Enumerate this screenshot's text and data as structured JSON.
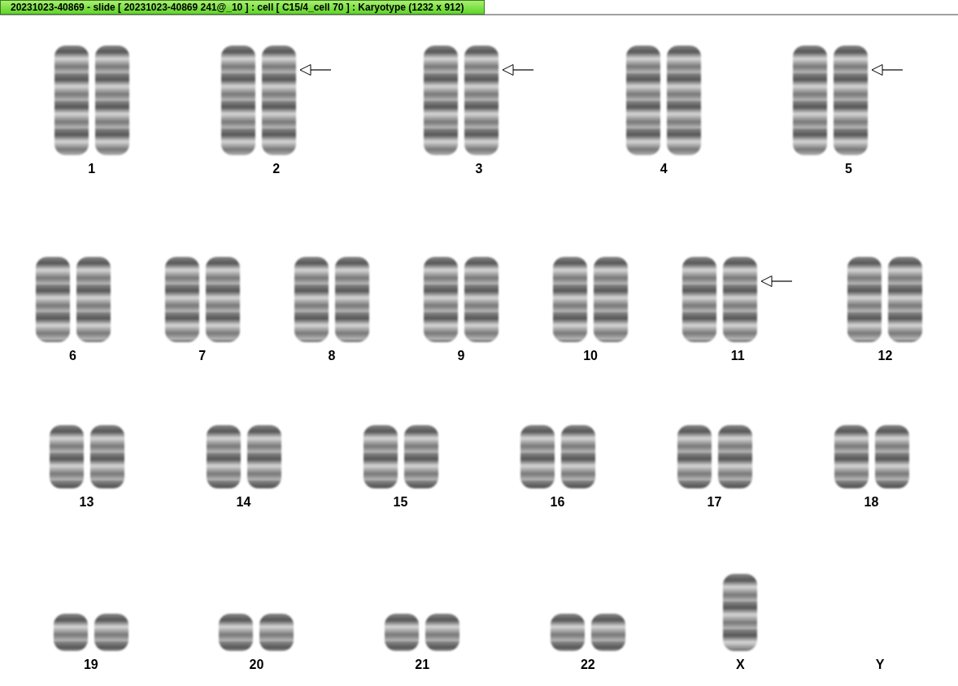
{
  "window": {
    "title": "20231023-40869 - slide [ 20231023-40869 241@_10 ] : cell [ C15/4_cell 70 ] : Karyotype  (1232 x 912)"
  },
  "rows": [
    {
      "groups": [
        {
          "label": "1",
          "chromosomes": [
            {
              "arrow": false
            },
            {
              "arrow": false
            }
          ]
        },
        {
          "label": "2",
          "chromosomes": [
            {
              "arrow": false
            },
            {
              "arrow": true
            }
          ]
        },
        {
          "label": "3",
          "chromosomes": [
            {
              "arrow": false
            },
            {
              "arrow": true
            }
          ]
        },
        {
          "label": "4",
          "chromosomes": [
            {
              "arrow": false
            },
            {
              "arrow": false
            }
          ]
        },
        {
          "label": "5",
          "chromosomes": [
            {
              "arrow": false
            },
            {
              "arrow": true
            }
          ]
        }
      ]
    },
    {
      "groups": [
        {
          "label": "6",
          "chromosomes": [
            {
              "arrow": false
            },
            {
              "arrow": false
            }
          ]
        },
        {
          "label": "7",
          "chromosomes": [
            {
              "arrow": false
            },
            {
              "arrow": false
            }
          ]
        },
        {
          "label": "8",
          "chromosomes": [
            {
              "arrow": false
            },
            {
              "arrow": false
            }
          ]
        },
        {
          "label": "9",
          "chromosomes": [
            {
              "arrow": false
            },
            {
              "arrow": false
            }
          ]
        },
        {
          "label": "10",
          "chromosomes": [
            {
              "arrow": false
            },
            {
              "arrow": false
            }
          ]
        },
        {
          "label": "11",
          "chromosomes": [
            {
              "arrow": false
            },
            {
              "arrow": true
            }
          ]
        },
        {
          "label": "12",
          "chromosomes": [
            {
              "arrow": false
            },
            {
              "arrow": false
            }
          ]
        }
      ]
    },
    {
      "groups": [
        {
          "label": "13",
          "chromosomes": [
            {
              "arrow": false
            },
            {
              "arrow": false
            }
          ]
        },
        {
          "label": "14",
          "chromosomes": [
            {
              "arrow": false
            },
            {
              "arrow": false
            }
          ]
        },
        {
          "label": "15",
          "chromosomes": [
            {
              "arrow": false
            },
            {
              "arrow": false
            }
          ]
        },
        {
          "label": "16",
          "chromosomes": [
            {
              "arrow": false
            },
            {
              "arrow": false
            }
          ]
        },
        {
          "label": "17",
          "chromosomes": [
            {
              "arrow": false
            },
            {
              "arrow": false
            }
          ]
        },
        {
          "label": "18",
          "chromosomes": [
            {
              "arrow": false
            },
            {
              "arrow": false
            }
          ]
        }
      ]
    },
    {
      "groups": [
        {
          "label": "19",
          "chromosomes": [
            {
              "arrow": false
            },
            {
              "arrow": false
            }
          ]
        },
        {
          "label": "20",
          "chromosomes": [
            {
              "arrow": false
            },
            {
              "arrow": false
            }
          ]
        },
        {
          "label": "21",
          "chromosomes": [
            {
              "arrow": false
            },
            {
              "arrow": false
            }
          ]
        },
        {
          "label": "22",
          "chromosomes": [
            {
              "arrow": false
            },
            {
              "arrow": false
            }
          ]
        },
        {
          "label": "X",
          "chromosomes": [
            {
              "arrow": false
            }
          ]
        },
        {
          "label": "Y"
        }
      ]
    }
  ]
}
